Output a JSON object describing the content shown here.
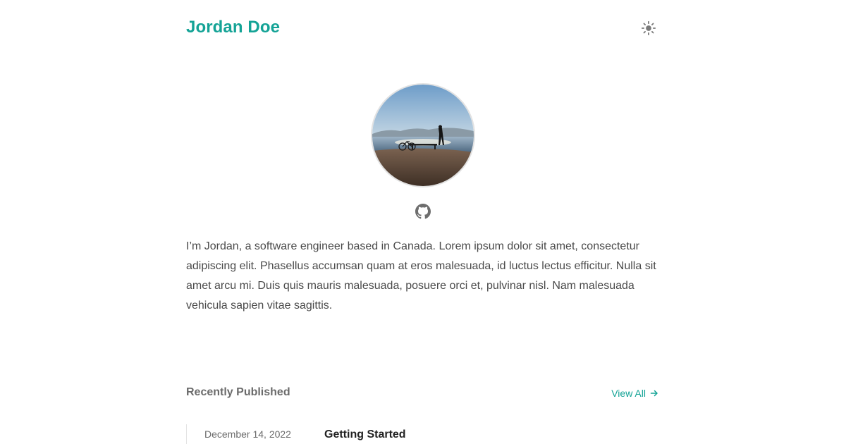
{
  "header": {
    "site_title": "Jordan Doe",
    "theme_toggle_icon": "sun-icon"
  },
  "profile": {
    "avatar_icon": "avatar-photo",
    "social_icon": "github-icon"
  },
  "bio": "I’m Jordan, a software engineer based in Canada. Lorem ipsum dolor sit amet, consectetur adipiscing elit. Phasellus accumsan quam at eros malesuada, id luctus lectus efficitur. Nulla sit amet arcu mi. Duis quis mauris malesuada, posuere orci et, pulvinar nisl. Nam malesuada vehicula sapien vitae sagittis.",
  "recent": {
    "heading": "Recently Published",
    "view_all_label": "View All",
    "posts": [
      {
        "date": "December 14, 2022",
        "title": "Getting Started"
      }
    ]
  },
  "colors": {
    "accent": "#14a396",
    "text": "#4a4a4a",
    "muted": "#6b6b6b"
  }
}
